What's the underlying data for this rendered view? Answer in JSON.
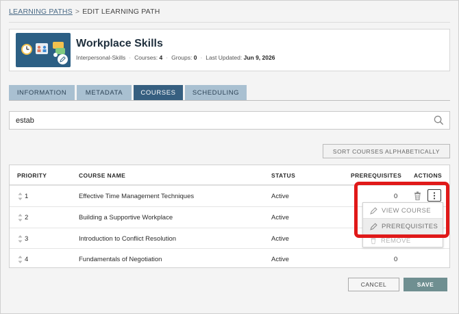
{
  "breadcrumb": {
    "parent": "LEARNING PATHS",
    "separator": ">",
    "current": "EDIT LEARNING PATH"
  },
  "header": {
    "title": "Workplace Skills",
    "category": "Interpersonal-Skills",
    "courses_label": "Courses:",
    "courses_count": "4",
    "groups_label": "Groups:",
    "groups_count": "0",
    "updated_label": "Last Updated:",
    "updated_date": "Jun 9, 2026",
    "thumbnail_icons": [
      "clock-icon",
      "people-icon",
      "chat-icon"
    ],
    "thumbnail_bg": "#2c5f84"
  },
  "tabs": [
    {
      "label": "INFORMATION",
      "active": false
    },
    {
      "label": "METADATA",
      "active": false
    },
    {
      "label": "COURSES",
      "active": true
    },
    {
      "label": "SCHEDULING",
      "active": false
    }
  ],
  "search": {
    "value": "estab",
    "icon": "search-icon"
  },
  "sort_button": "SORT COURSES ALPHABETICALLY",
  "table": {
    "columns": [
      "PRIORITY",
      "COURSE NAME",
      "STATUS",
      "PREREQUISITES",
      "ACTIONS"
    ],
    "rows": [
      {
        "priority": "1",
        "name": "Effective Time Management Techniques",
        "status": "Active",
        "prereq": "0"
      },
      {
        "priority": "2",
        "name": "Building a Supportive Workplace",
        "status": "Active",
        "prereq": ""
      },
      {
        "priority": "3",
        "name": "Introduction to Conflict Resolution",
        "status": "Active",
        "prereq": ""
      },
      {
        "priority": "4",
        "name": "Fundamentals of Negotiation",
        "status": "Active",
        "prereq": "0"
      }
    ]
  },
  "dropdown": {
    "items": [
      "VIEW COURSE",
      "PREREQUISITES"
    ],
    "ghost_item": "REMOVE"
  },
  "footer": {
    "cancel": "CANCEL",
    "save": "SAVE"
  },
  "colors": {
    "accent": "#365f80",
    "tab_inactive": "#a9c0d1",
    "save": "#6f8f91",
    "highlight": "#e01919"
  }
}
